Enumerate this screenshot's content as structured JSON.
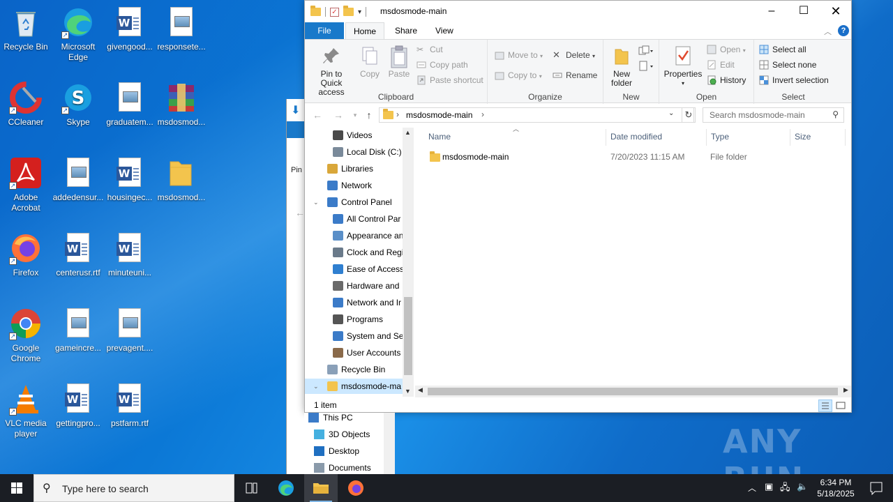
{
  "desktop": {
    "icons": [
      {
        "label": "Recycle Bin",
        "icon": "recycle-bin-icon"
      },
      {
        "label": "Microsoft Edge",
        "icon": "edge-icon"
      },
      {
        "label": "givengood...",
        "icon": "word-doc-icon"
      },
      {
        "label": "responsete...",
        "icon": "image-file-icon"
      },
      {
        "label": "CCleaner",
        "icon": "ccleaner-icon"
      },
      {
        "label": "Skype",
        "icon": "skype-icon"
      },
      {
        "label": "graduatem...",
        "icon": "image-file-icon"
      },
      {
        "label": "msdosmod...",
        "icon": "winrar-icon"
      },
      {
        "label": "Adobe Acrobat",
        "icon": "acrobat-icon"
      },
      {
        "label": "addedensur...",
        "icon": "image-file-icon"
      },
      {
        "label": "housingec...",
        "icon": "word-doc-icon"
      },
      {
        "label": "msdosmod...",
        "icon": "folder-icon"
      },
      {
        "label": "Firefox",
        "icon": "firefox-icon"
      },
      {
        "label": "centerusr.rtf",
        "icon": "word-doc-icon"
      },
      {
        "label": "minuteuni...",
        "icon": "word-doc-icon"
      },
      {
        "label": "Google Chrome",
        "icon": "chrome-icon"
      },
      {
        "label": "gameincre...",
        "icon": "image-file-icon"
      },
      {
        "label": "prevagent....",
        "icon": "image-file-icon"
      },
      {
        "label": "VLC media player",
        "icon": "vlc-icon"
      },
      {
        "label": "gettingpro...",
        "icon": "word-doc-icon"
      },
      {
        "label": "pstfarm.rtf",
        "icon": "word-doc-icon"
      }
    ]
  },
  "explorer": {
    "title": "msdosmode-main",
    "tabs": {
      "file": "File",
      "home": "Home",
      "share": "Share",
      "view": "View"
    },
    "ribbon": {
      "clipboard": {
        "group": "Clipboard",
        "pin": "Pin to Quick access",
        "copy": "Copy",
        "paste": "Paste",
        "cut": "Cut",
        "copy_path": "Copy path",
        "paste_shortcut": "Paste shortcut"
      },
      "organize": {
        "group": "Organize",
        "move_to": "Move to",
        "copy_to": "Copy to",
        "delete": "Delete",
        "rename": "Rename"
      },
      "new": {
        "group": "New",
        "new_folder": "New folder"
      },
      "open": {
        "group": "Open",
        "properties": "Properties",
        "open": "Open",
        "edit": "Edit",
        "history": "History"
      },
      "select": {
        "group": "Select",
        "select_all": "Select all",
        "select_none": "Select none",
        "invert": "Invert selection"
      }
    },
    "address": "msdosmode-main",
    "search_placeholder": "Search msdosmode-main",
    "nav_items": [
      "Videos",
      "Local Disk (C:)",
      "Libraries",
      "Network",
      "Control Panel",
      "All Control Par",
      "Appearance an",
      "Clock and Regi",
      "Ease of Access",
      "Hardware and",
      "Network and Ir",
      "Programs",
      "System and Sec",
      "User Accounts",
      "Recycle Bin",
      "msdosmode-ma"
    ],
    "columns": {
      "name": "Name",
      "date": "Date modified",
      "type": "Type",
      "size": "Size"
    },
    "rows": [
      {
        "name": "msdosmode-main",
        "date": "7/20/2023 11:15 AM",
        "type": "File folder",
        "size": ""
      }
    ],
    "status": "1 item"
  },
  "lower_nav": [
    "This PC",
    "3D Objects",
    "Desktop",
    "Documents"
  ],
  "taskbar": {
    "search_placeholder": "Type here to search",
    "time": "6:34 PM",
    "date": "5/18/2025"
  },
  "watermark": "ANY RUN"
}
